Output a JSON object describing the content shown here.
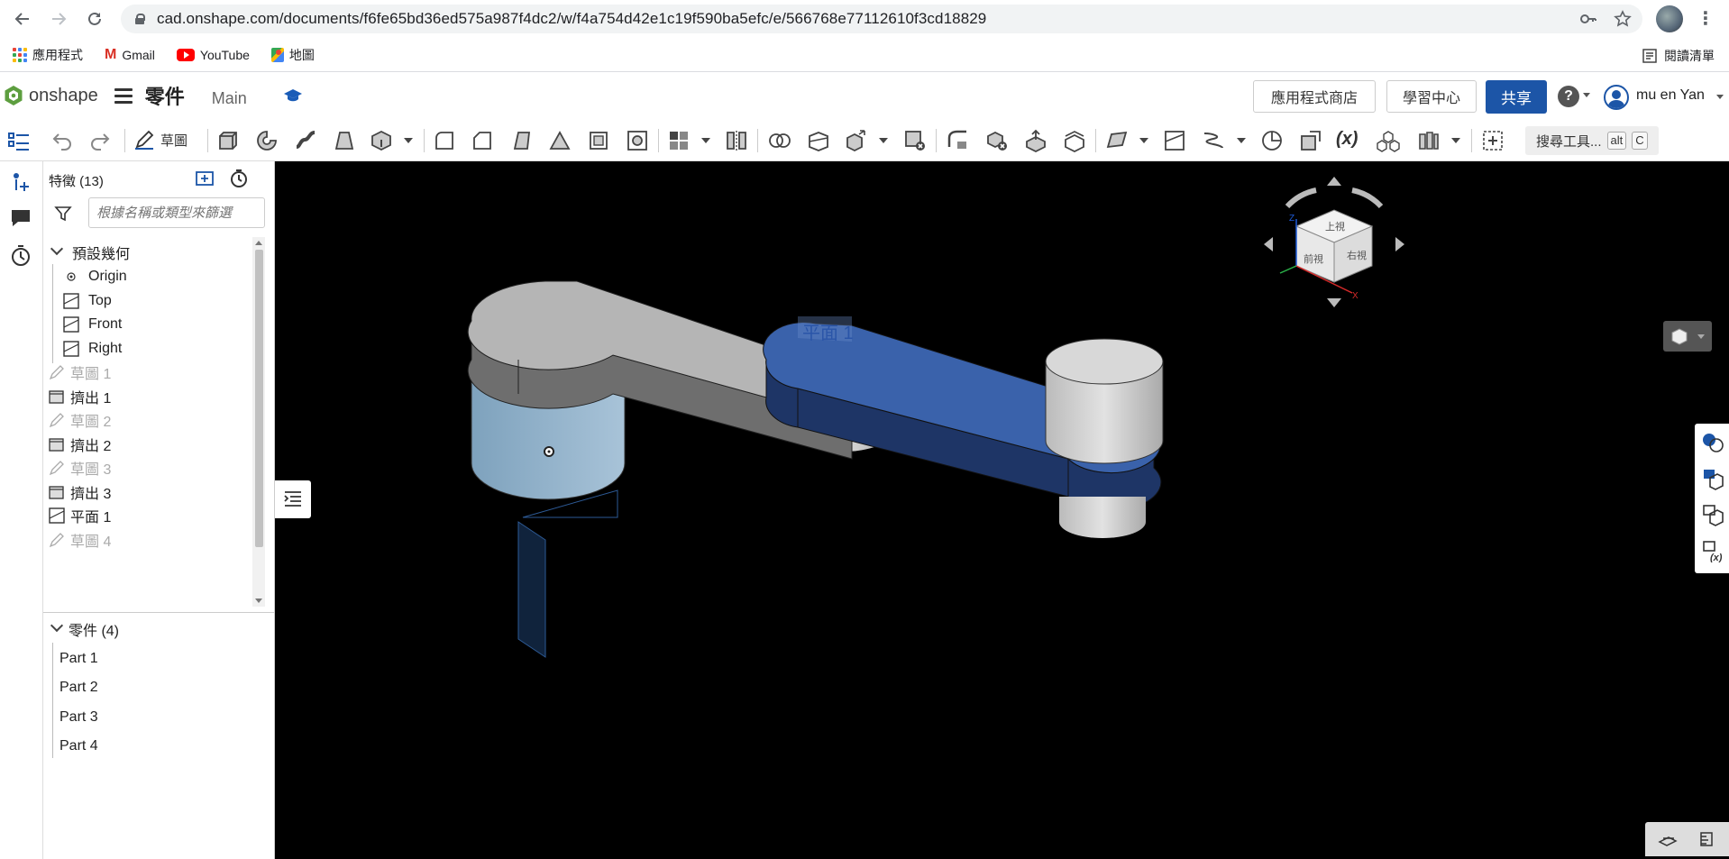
{
  "browser": {
    "url": "cad.onshape.com/documents/f6fe65bd36ed575a987f4dc2/w/f4a754d42e1c19f590ba5efc/e/566768e77112610f3cd18829",
    "bookmarks": [
      {
        "label": "應用程式",
        "icon": "apps-icon"
      },
      {
        "label": "Gmail",
        "icon": "gmail-icon"
      },
      {
        "label": "YouTube",
        "icon": "youtube-icon"
      },
      {
        "label": "地圖",
        "icon": "maps-icon"
      }
    ],
    "reading_list": "閱讀清單"
  },
  "header": {
    "logo_text": "onshape",
    "doc_title": "零件",
    "branch": "Main",
    "app_store_label": "應用程式商店",
    "learning_center_label": "學習中心",
    "share_label": "共享",
    "help_label": "?",
    "user_name": "mu en Yan"
  },
  "toolbar": {
    "sketch_label": "草圖",
    "search_tools_label": "搜尋工具...",
    "search_shortcut_mod": "alt",
    "search_shortcut_key": "C"
  },
  "feature_panel": {
    "title": "特徵 (13)",
    "filter_placeholder": "根據名稱或類型來篩選",
    "default_geometry": "預設幾何",
    "geometry_items": [
      "Origin",
      "Top",
      "Front",
      "Right"
    ],
    "features": [
      {
        "label": "草圖 1",
        "type": "sketch",
        "dim": true
      },
      {
        "label": "擠出 1",
        "type": "extrude",
        "dim": false
      },
      {
        "label": "草圖 2",
        "type": "sketch",
        "dim": true
      },
      {
        "label": "擠出 2",
        "type": "extrude",
        "dim": false
      },
      {
        "label": "草圖 3",
        "type": "sketch",
        "dim": true
      },
      {
        "label": "擠出 3",
        "type": "extrude",
        "dim": false
      },
      {
        "label": "平面 1",
        "type": "plane",
        "dim": false
      },
      {
        "label": "草圖 4",
        "type": "sketch",
        "dim": true
      }
    ],
    "parts_header": "零件 (4)",
    "parts": [
      "Part 1",
      "Part 2",
      "Part 3",
      "Part 4"
    ]
  },
  "viewport": {
    "plane_label": "平面 1",
    "view_cube": {
      "top": "上視",
      "front": "前視",
      "right": "右視",
      "axis_x": "X",
      "axis_z": "Z"
    }
  }
}
